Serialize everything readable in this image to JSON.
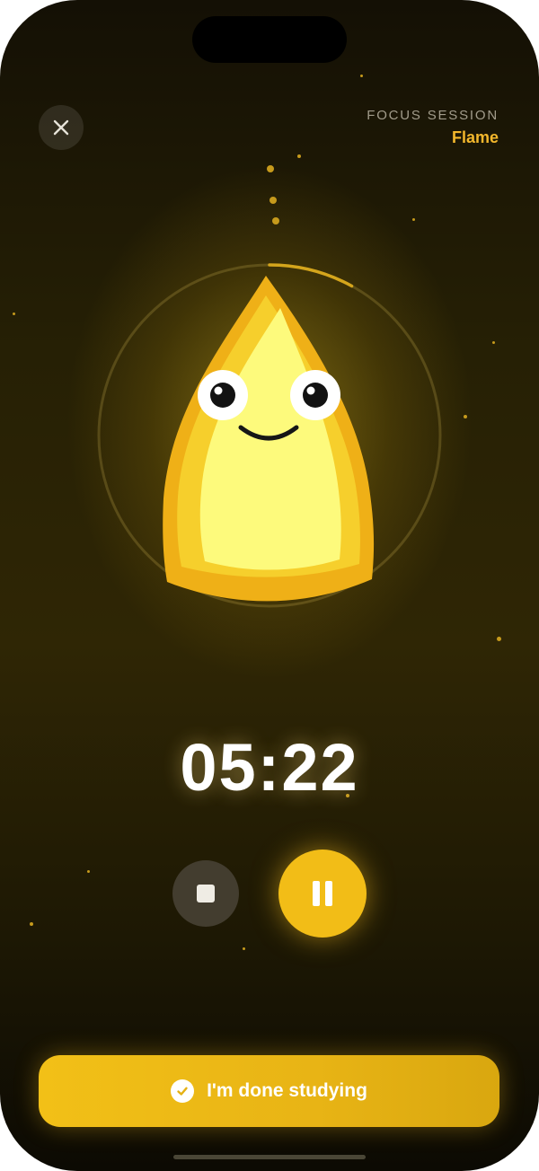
{
  "header": {
    "session_label": "FOCUS SESSION",
    "session_name": "Flame"
  },
  "close": {
    "icon": "close-icon"
  },
  "timer": {
    "value": "05:22"
  },
  "progress": {
    "fraction": 0.08
  },
  "controls": {
    "stop_icon": "stop-icon",
    "pause_icon": "pause-icon"
  },
  "done": {
    "label": "I'm done studying",
    "icon": "check-icon"
  },
  "colors": {
    "accent": "#f2bd17",
    "accent_text": "#f3b72c",
    "background": "#2a2305"
  }
}
